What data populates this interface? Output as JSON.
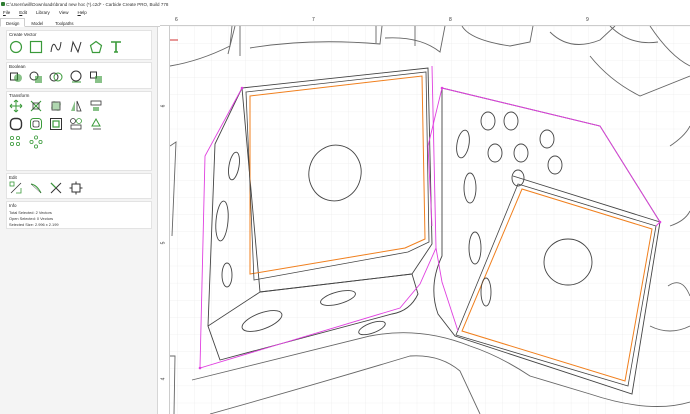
{
  "window": {
    "title": "C:\\Users\\will\\Downloads\\brand new hoc (*).c2d* - Carbide Create PRO, Build 778"
  },
  "menu": [
    {
      "underline": "F",
      "rest": "ile"
    },
    {
      "underline": "E",
      "rest": "dit"
    },
    {
      "underline": "",
      "rest": "Library"
    },
    {
      "underline": "",
      "rest": "View"
    },
    {
      "underline": "H",
      "rest": "elp"
    }
  ],
  "tabs": [
    "Design",
    "Model",
    "Toolpaths"
  ],
  "sections": {
    "create_vector": "Create Vector",
    "boolean": "Boolean",
    "transform": "Transform",
    "edit": "Edit",
    "info": "Info"
  },
  "info": {
    "total_selected": "Total Selected:   2 Vectors",
    "open_selected": "Open Selected:   0 Vectors",
    "selected_size": "Selected Size:   2.996 x 2.199"
  },
  "ruler": {
    "top_labels": [
      "6",
      "7",
      "8",
      "9"
    ],
    "left_labels": [
      "6",
      "5",
      "4"
    ]
  },
  "colors": {
    "accent_green": "#3a9a3a",
    "selection_orange": "#f07f1d",
    "path_magenta": "#e040e0",
    "outline_gray": "#555555",
    "grid": "#e4e4e4"
  }
}
